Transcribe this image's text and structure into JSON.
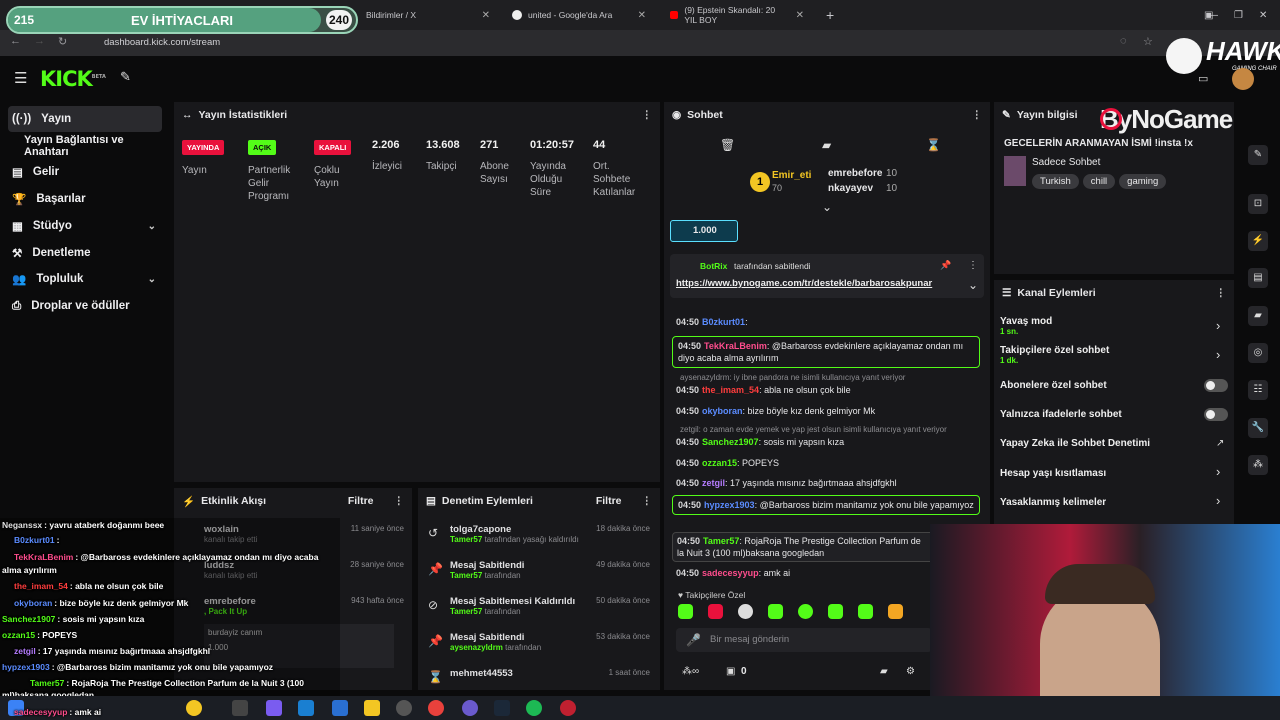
{
  "poll": {
    "left_count": "215",
    "title": "EV İHTİYACLARI",
    "right_count": "240",
    "progress": 0.9
  },
  "browser": {
    "tabs": [
      {
        "label": "Bildirimler / X"
      },
      {
        "label": "united - Google'da Ara"
      },
      {
        "label": "(9) Epstein Skandalı: 20 YIL BOY"
      }
    ],
    "url": "dashboard.kick.com/stream"
  },
  "header": {
    "logo": "KICK",
    "beta": "BETA"
  },
  "sidebar": {
    "items": [
      {
        "label": "Yayın",
        "icon": "broadcast-icon"
      },
      {
        "label": "Yayın Bağlantısı ve Anahtarı",
        "icon": "key-icon"
      },
      {
        "label": "Gelir",
        "icon": "money-icon"
      },
      {
        "label": "Başarılar",
        "icon": "trophy-icon"
      },
      {
        "label": "Stüdyo",
        "icon": "studio-icon"
      },
      {
        "label": "Denetleme",
        "icon": "hammer-icon"
      },
      {
        "label": "Topluluk",
        "icon": "users-icon"
      },
      {
        "label": "Droplar ve ödüller",
        "icon": "gift-icon"
      }
    ]
  },
  "stats": {
    "title": "Yayın İstatistikleri",
    "badges": [
      {
        "badge": "YAYINDA",
        "label": "Yayın",
        "color": "#e9113c"
      },
      {
        "badge": "AÇIK",
        "label": "Partnerlik Gelir Programı",
        "color": "#53fc18"
      },
      {
        "badge": "KAPALI",
        "label": "Çoklu Yayın",
        "color": "#e9113c"
      }
    ],
    "metrics": [
      {
        "value": "2.206",
        "label": "İzleyici"
      },
      {
        "value": "13.608",
        "label": "Takipçi"
      },
      {
        "value": "271",
        "label": "Abone Sayısı"
      },
      {
        "value": "01:20:57",
        "label": "Yayında Olduğu Süre"
      },
      {
        "value": "44",
        "label": "Ort. Sohbete Katılanlar"
      }
    ]
  },
  "activity": {
    "title": "Etkinlik Akışı",
    "filter": "Filtre",
    "events": [
      {
        "name": "woxlain",
        "desc": "kanalı takip etti",
        "time": "11 saniye önce"
      },
      {
        "name": "luddsz",
        "desc": "kanalı takip etti",
        "time": "28 saniye önce"
      },
      {
        "name": "emrebefore",
        "desc": ", Pack It Up",
        "time": "943 hafta önce",
        "note": "burdayiz canım",
        "amount": "1.000"
      }
    ]
  },
  "moderation": {
    "title": "Denetim Eylemleri",
    "filter": "Filtre",
    "actions": [
      {
        "title": "tolga7capone",
        "by": "Tamer57",
        "desc": "tarafından yasağı kaldırıldı",
        "time": "18 dakika önce"
      },
      {
        "title": "Mesaj Sabitlendi",
        "by": "Tamer57",
        "desc": "tarafından",
        "time": "49 dakika önce"
      },
      {
        "title": "Mesaj Sabitlemesi Kaldırıldı",
        "by": "Tamer57",
        "desc": "tarafından",
        "time": "50 dakika önce"
      },
      {
        "title": "Mesaj Sabitlendi",
        "by": "aysenazyldrm",
        "desc": "tarafından",
        "time": "53 dakika önce"
      },
      {
        "title": "mehmet44553",
        "by": "",
        "desc": "",
        "time": "1 saat önce"
      }
    ]
  },
  "chat": {
    "title": "Sohbet",
    "leaders": [
      {
        "name": "Emir_eti",
        "count": "70",
        "rank": "1"
      },
      {
        "name": "emrebefore",
        "count": "10"
      },
      {
        "name": "nkayayev",
        "count": "10"
      }
    ],
    "kicks": "1.000",
    "pinned": {
      "by": "BotRix",
      "suffix": "tarafından sabitlendi",
      "link": "https://www.bynogame.com/tr/destekle/barbarosakpunar"
    },
    "messages": [
      {
        "time": "04:50",
        "user": "B0zkurt01",
        "text": ":",
        "color": "#5b8cff"
      },
      {
        "time": "04:50",
        "user": "TekKraLBenim",
        "text": ": @Barbaross evdekinlere açıklayamaz ondan mı diyo acaba alma ayrılırım",
        "color": "#ff4d8d",
        "boxed": true
      },
      {
        "sys": "aysenazyldrm: iy ibne pandora ne isimli kullanıcıya yanıt veriyor"
      },
      {
        "time": "04:50",
        "user": "the_imam_54",
        "text": ": abla ne olsun çok bile",
        "color": "#ff3d3d"
      },
      {
        "time": "04:50",
        "user": "okyboran",
        "text": ": bize böyle kız denk gelmiyor Mk",
        "color": "#5b8cff"
      },
      {
        "sys": "zetgil: o zaman evde yemek ve yap jest olsun isimli kullanıcıya yanıt veriyor"
      },
      {
        "time": "04:50",
        "user": "Sanchez1907",
        "text": ": sosis mi yapsın kıza",
        "color": "#53fc18"
      },
      {
        "time": "04:50",
        "user": "ozzan15",
        "text": ": POPEYS",
        "color": "#53fc18"
      },
      {
        "time": "04:50",
        "user": "zetgil",
        "text": ": 17 yaşında mısınız bağırtmaaa ahsjdfgkhl",
        "color": "#b57cff"
      },
      {
        "time": "04:50",
        "user": "hypzex1903",
        "text": ": @Barbaross bizim manitamız yok onu bile yapamıyoz",
        "color": "#5b8cff",
        "boxed": true
      },
      {
        "time": "04:50",
        "user": "Tamer57",
        "text": ": RojaRoja The Prestige Collection Parfum de la Nuit 3 (100 ml)baksana googledan",
        "color": "#53fc18",
        "boxed2": true
      },
      {
        "time": "04:50",
        "user": "sadecesyyup",
        "text": ": amk ai",
        "color": "#ff4d8d"
      }
    ],
    "followers_only": "Takipçilere Özel",
    "input_placeholder": "Bir mesaj gönderin",
    "points": "0"
  },
  "stream_info": {
    "title": "Yayın bilgisi",
    "stream_title": "GECELERİN ARANMAYAN İSMİ !insta !x",
    "category": "Sadece Sohbet",
    "tags": [
      "Turkish",
      "chill",
      "gaming"
    ],
    "overlay_brand": "ByNoGame",
    "hawk_brand": "HAWK",
    "hawk_sub": "GAMING CHAIR"
  },
  "channel_actions": {
    "title": "Kanal Eylemleri",
    "items": [
      {
        "label": "Yavaş mod",
        "sub": "1 sn.",
        "type": "arrow"
      },
      {
        "label": "Takipçilere özel sohbet",
        "sub": "1 dk.",
        "type": "arrow"
      },
      {
        "label": "Abonelere özel sohbet",
        "type": "toggle"
      },
      {
        "label": "Yalnızca ifadelerle sohbet",
        "type": "toggle"
      },
      {
        "label": "Yapay Zeka ile Sohbet Denetimi",
        "type": "ext"
      },
      {
        "label": "Hesap yaşı kısıtlaması",
        "type": "arrow"
      },
      {
        "label": "Yasaklanmış kelimeler",
        "type": "arrow"
      }
    ]
  },
  "overlay_chat": [
    {
      "user": "Neganssx",
      "text": ": yavru ataberk doğanmı beee",
      "color": "#e0e0e0"
    },
    {
      "user": "B0zkurt01",
      "text": ":",
      "color": "#5b8cff"
    },
    {
      "user": "TekKraLBenim",
      "text": ": @Barbaross evdekinlere açıklayamaz ondan mı diyo acaba",
      "color": "#ff4d8d"
    },
    {
      "user": "",
      "text": "alma ayrılırım",
      "color": "#fff"
    },
    {
      "user": "the_imam_54",
      "text": ": abla ne olsun çok bile",
      "color": "#ff3d3d"
    },
    {
      "user": "okyboran",
      "text": ": bize böyle kız denk gelmiyor Mk",
      "color": "#5b8cff"
    },
    {
      "user": "Sanchez1907",
      "text": ": sosis mi yapsın kıza",
      "color": "#53fc18"
    },
    {
      "user": "ozzan15",
      "text": ": POPEYS",
      "color": "#53fc18"
    },
    {
      "user": "zetgil",
      "text": ": 17 yaşında mısınız bağırtmaaa ahsjdfgkhl",
      "color": "#b57cff"
    },
    {
      "user": "hypzex1903",
      "text": ": @Barbaross bizim manitamız yok onu bile yapamıyoz",
      "color": "#5b8cff"
    },
    {
      "user": "Tamer57",
      "text": ": RojaRoja The Prestige Collection Parfum de la Nuit 3 (100",
      "color": "#53fc18"
    },
    {
      "user": "",
      "text": "ml)baksana googledan",
      "color": "#fff"
    },
    {
      "user": "sadecesyyup",
      "text": ": amk ai",
      "color": "#ff4d8d"
    }
  ]
}
